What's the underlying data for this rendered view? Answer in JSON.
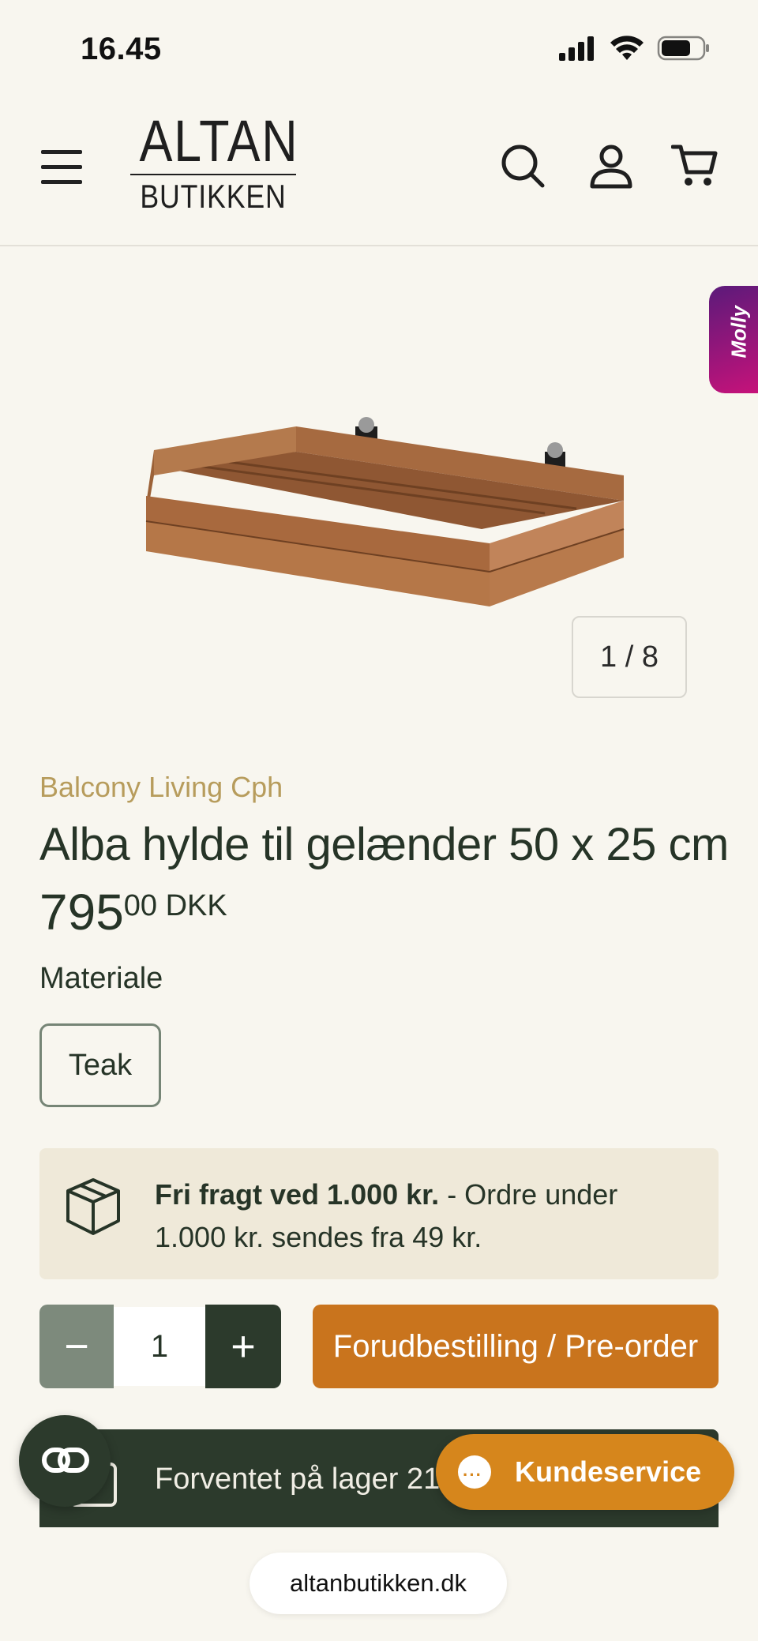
{
  "status_bar": {
    "time": "16.45"
  },
  "header": {
    "logo_top": "ALTAN",
    "logo_bottom": "BUTIKKEN",
    "icons": [
      "menu-icon",
      "search-icon",
      "account-icon",
      "cart-icon"
    ]
  },
  "side_tab": {
    "label": "Molly"
  },
  "gallery": {
    "counter": "1 / 8"
  },
  "product": {
    "brand": "Balcony Living Cph",
    "title": "Alba hylde til gelænder 50 x 25 cm",
    "price_main": "795",
    "price_decimals": "00 DKK",
    "option_label": "Materiale",
    "option_selected": "Teak"
  },
  "shipping": {
    "bold": "Fri fragt ved 1.000 kr.",
    "rest": " - Ordre under 1.000 kr. sendes fra 49 kr."
  },
  "purchase": {
    "minus": "−",
    "quantity": "1",
    "plus": "+",
    "button_label": "Forudbestilling / Pre-order"
  },
  "stock_banner": {
    "text": "Forventet på lager 21.-30. ju"
  },
  "support": {
    "label": "Kundeservice",
    "bubble": "···"
  },
  "browser": {
    "url": "altanbutikken.dk"
  },
  "colors": {
    "background": "#f8f6ef",
    "primary_dark": "#2c3a2c",
    "accent_orange": "#c9741d",
    "brand_gold": "#b79c5c",
    "shipping_bg": "#efe9d9",
    "support_orange": "#d6861c"
  }
}
